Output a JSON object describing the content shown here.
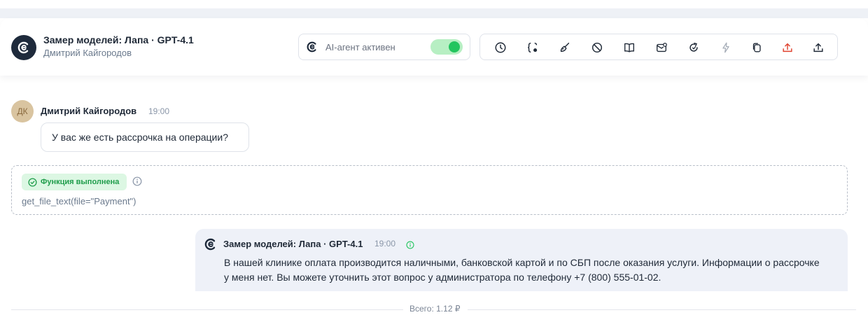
{
  "header": {
    "title": "Замер моделей: Лапа · GPT-4.1",
    "subtitle": "Дмитрий Кайгородов"
  },
  "agent": {
    "label": "AI-агент активен",
    "enabled": true
  },
  "toolbar": {
    "icons": [
      "clock-icon",
      "variables-icon",
      "broom-icon",
      "block-icon",
      "book-icon",
      "mail-icon",
      "refresh-icon",
      "lightning-icon",
      "copy-icon",
      "upload-red-icon",
      "upload-icon"
    ]
  },
  "messages": {
    "user": {
      "avatar_initials": "ДК",
      "name": "Дмитрий Кайгородов",
      "time": "19:00",
      "text": "У вас же есть рассрочка на операции?"
    },
    "function": {
      "status": "Функция выполнена",
      "call": "get_file_text(file=\"Payment\")"
    },
    "bot": {
      "name": "Замер моделей: Лапа · GPT-4.1",
      "time": "19:00",
      "text": "В нашей клинике оплата производится наличными, банковской картой и по СБП после оказания услуги. Информации о рассрочке у меня нет. Вы можете уточнить этот вопрос у администратора по телефону +7 (800) 555-01-02."
    }
  },
  "footer": {
    "total": "Всего: 1.12 ₽"
  },
  "colors": {
    "accent_green": "#22c55e",
    "logo_dark": "#1e2a3b",
    "export_red": "#e0422f"
  }
}
